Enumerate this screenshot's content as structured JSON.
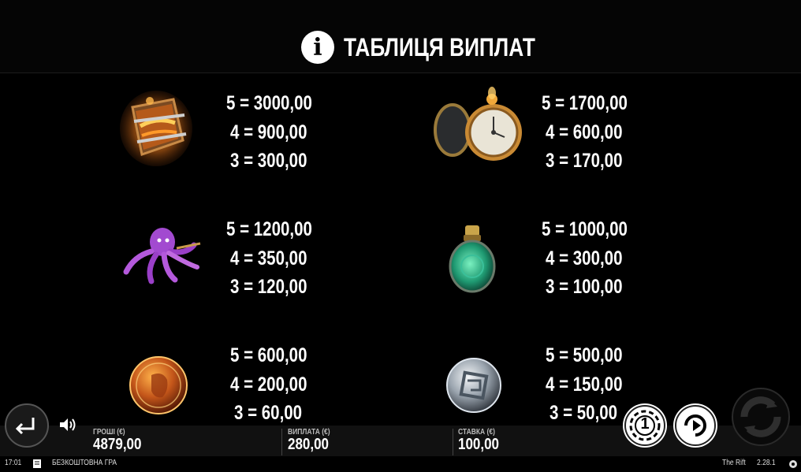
{
  "header": {
    "title": "ТАБЛИЦЯ ВИПЛАТ",
    "info_icon_glyph": "i"
  },
  "symbols": [
    {
      "icon": "burning-book-icon",
      "pays": [
        "5 = 3000,00",
        "4 = 900,00",
        "3 = 300,00"
      ]
    },
    {
      "icon": "pocket-watch-icon",
      "pays": [
        "5 = 1700,00",
        "4 = 600,00",
        "3 = 170,00"
      ]
    },
    {
      "icon": "octopus-icon",
      "pays": [
        "5 = 1200,00",
        "4 = 350,00",
        "3 = 120,00"
      ]
    },
    {
      "icon": "green-potion-icon",
      "pays": [
        "5 = 1000,00",
        "4 = 300,00",
        "3 = 100,00"
      ]
    },
    {
      "icon": "gold-coin-icon",
      "pays": [
        "5 = 600,00",
        "4 = 200,00",
        "3 = 60,00"
      ]
    },
    {
      "icon": "silver-coin-icon",
      "pays": [
        "5 = 500,00",
        "4 = 150,00",
        "3 = 50,00"
      ]
    }
  ],
  "bottom_bar": {
    "balance_label": "ГРОШІ (€)",
    "balance_value": "4879,00",
    "win_label": "ВИПЛАТА (€)",
    "win_value": "280,00",
    "bet_label": "СТАВКА (€)",
    "bet_value": "100,00"
  },
  "status_bar": {
    "time": "17:01",
    "mode": "БЕЗКОШТОВНА ГРА",
    "game_name": "The Rift",
    "version": "2.28.1"
  },
  "buttons": {
    "back_icon": "back-arrow-icon",
    "sound_icon": "speaker-icon",
    "coin_icon": "coin-value-icon",
    "autoplay_icon": "autoplay-icon",
    "spin_icon": "spin-icon",
    "coin_glyph": "1"
  },
  "colors": {
    "background": "#000000",
    "text": "#ffffff"
  }
}
